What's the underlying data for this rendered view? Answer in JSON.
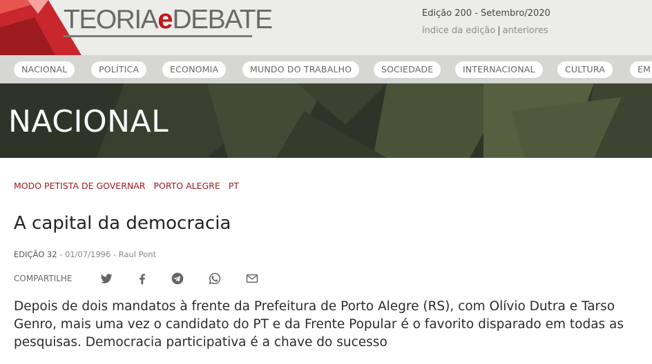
{
  "brand": {
    "logo_part1": "TEORIA",
    "logo_part2": "e",
    "logo_part3": "DEBATE",
    "accent_color": "#c4161c"
  },
  "edition": {
    "label": "Edição 200 - Setembro/2020",
    "index_link": "índice da edição",
    "separator": "|",
    "previous_link": "anteriores"
  },
  "nav": {
    "items": [
      {
        "label": "NACIONAL"
      },
      {
        "label": "POLÍTICA"
      },
      {
        "label": "ECONOMIA"
      },
      {
        "label": "MUNDO DO TRABALHO"
      },
      {
        "label": "SOCIEDADE"
      },
      {
        "label": "INTERNACIONAL"
      },
      {
        "label": "CULTURA"
      },
      {
        "label": "EM"
      }
    ]
  },
  "section": {
    "title": "NACIONAL"
  },
  "article": {
    "tags": [
      "MODO PETISTA DE GOVERNAR",
      "PORTO ALEGRE",
      "PT"
    ],
    "title": "A capital da democracia",
    "edition": "EDIÇÃO 32",
    "meta_rest": " - 01/07/1996 - Raul Pont",
    "share_label": "COMPARTILHE",
    "share_icons": [
      "twitter-icon",
      "facebook-icon",
      "telegram-icon",
      "whatsapp-icon",
      "email-icon"
    ],
    "lead": "Depois de dois mandatos à frente da Prefeitura de Porto Alegre (RS), com Olívio Dutra e Tarso Genro, mais uma vez o candidato do PT e da Frente Popular é o favorito disparado em todas as pesquisas. Democracia participativa é a chave do sucesso"
  }
}
